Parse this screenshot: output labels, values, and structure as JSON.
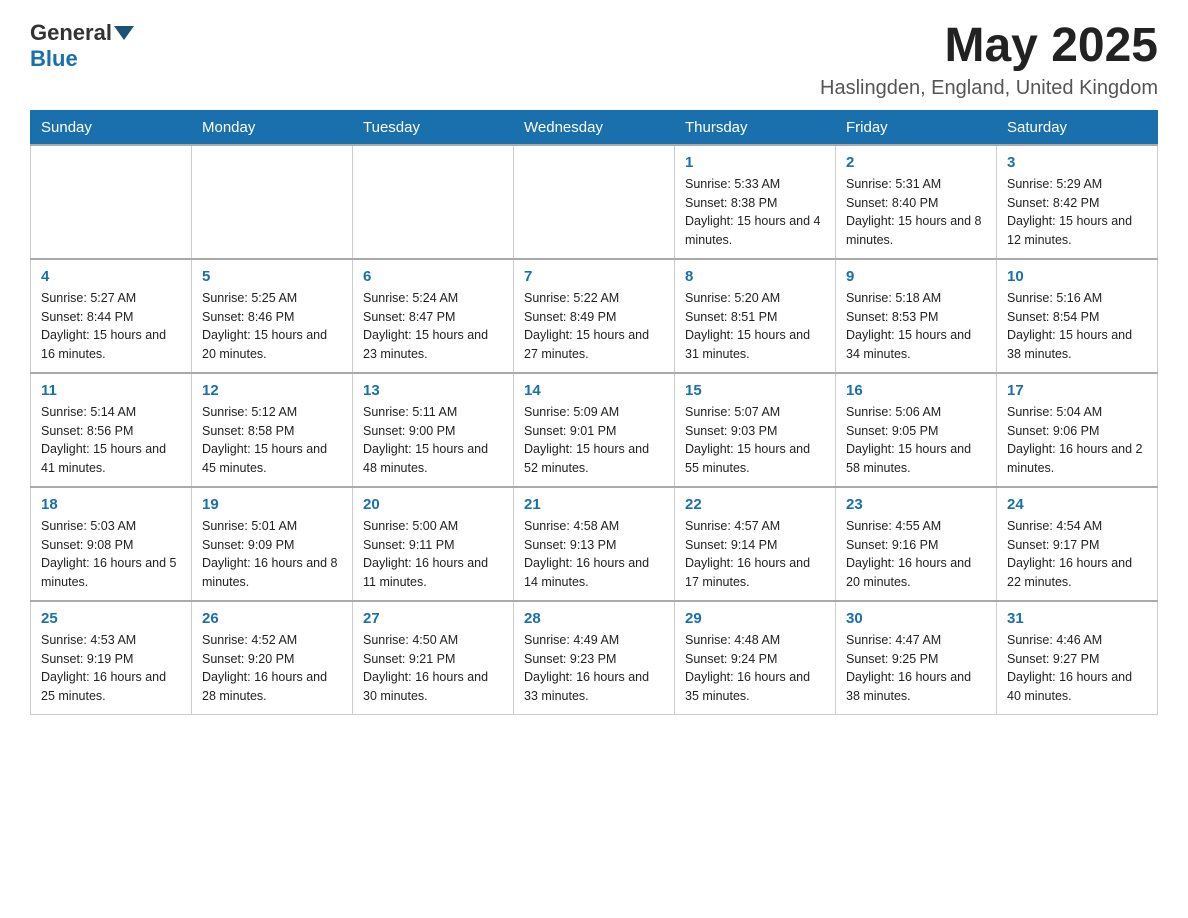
{
  "header": {
    "logo_general": "General",
    "logo_blue": "Blue",
    "month_title": "May 2025",
    "location": "Haslingden, England, United Kingdom"
  },
  "days_of_week": [
    "Sunday",
    "Monday",
    "Tuesday",
    "Wednesday",
    "Thursday",
    "Friday",
    "Saturday"
  ],
  "weeks": [
    [
      {
        "day": "",
        "info": ""
      },
      {
        "day": "",
        "info": ""
      },
      {
        "day": "",
        "info": ""
      },
      {
        "day": "",
        "info": ""
      },
      {
        "day": "1",
        "info": "Sunrise: 5:33 AM\nSunset: 8:38 PM\nDaylight: 15 hours and 4 minutes."
      },
      {
        "day": "2",
        "info": "Sunrise: 5:31 AM\nSunset: 8:40 PM\nDaylight: 15 hours and 8 minutes."
      },
      {
        "day": "3",
        "info": "Sunrise: 5:29 AM\nSunset: 8:42 PM\nDaylight: 15 hours and 12 minutes."
      }
    ],
    [
      {
        "day": "4",
        "info": "Sunrise: 5:27 AM\nSunset: 8:44 PM\nDaylight: 15 hours and 16 minutes."
      },
      {
        "day": "5",
        "info": "Sunrise: 5:25 AM\nSunset: 8:46 PM\nDaylight: 15 hours and 20 minutes."
      },
      {
        "day": "6",
        "info": "Sunrise: 5:24 AM\nSunset: 8:47 PM\nDaylight: 15 hours and 23 minutes."
      },
      {
        "day": "7",
        "info": "Sunrise: 5:22 AM\nSunset: 8:49 PM\nDaylight: 15 hours and 27 minutes."
      },
      {
        "day": "8",
        "info": "Sunrise: 5:20 AM\nSunset: 8:51 PM\nDaylight: 15 hours and 31 minutes."
      },
      {
        "day": "9",
        "info": "Sunrise: 5:18 AM\nSunset: 8:53 PM\nDaylight: 15 hours and 34 minutes."
      },
      {
        "day": "10",
        "info": "Sunrise: 5:16 AM\nSunset: 8:54 PM\nDaylight: 15 hours and 38 minutes."
      }
    ],
    [
      {
        "day": "11",
        "info": "Sunrise: 5:14 AM\nSunset: 8:56 PM\nDaylight: 15 hours and 41 minutes."
      },
      {
        "day": "12",
        "info": "Sunrise: 5:12 AM\nSunset: 8:58 PM\nDaylight: 15 hours and 45 minutes."
      },
      {
        "day": "13",
        "info": "Sunrise: 5:11 AM\nSunset: 9:00 PM\nDaylight: 15 hours and 48 minutes."
      },
      {
        "day": "14",
        "info": "Sunrise: 5:09 AM\nSunset: 9:01 PM\nDaylight: 15 hours and 52 minutes."
      },
      {
        "day": "15",
        "info": "Sunrise: 5:07 AM\nSunset: 9:03 PM\nDaylight: 15 hours and 55 minutes."
      },
      {
        "day": "16",
        "info": "Sunrise: 5:06 AM\nSunset: 9:05 PM\nDaylight: 15 hours and 58 minutes."
      },
      {
        "day": "17",
        "info": "Sunrise: 5:04 AM\nSunset: 9:06 PM\nDaylight: 16 hours and 2 minutes."
      }
    ],
    [
      {
        "day": "18",
        "info": "Sunrise: 5:03 AM\nSunset: 9:08 PM\nDaylight: 16 hours and 5 minutes."
      },
      {
        "day": "19",
        "info": "Sunrise: 5:01 AM\nSunset: 9:09 PM\nDaylight: 16 hours and 8 minutes."
      },
      {
        "day": "20",
        "info": "Sunrise: 5:00 AM\nSunset: 9:11 PM\nDaylight: 16 hours and 11 minutes."
      },
      {
        "day": "21",
        "info": "Sunrise: 4:58 AM\nSunset: 9:13 PM\nDaylight: 16 hours and 14 minutes."
      },
      {
        "day": "22",
        "info": "Sunrise: 4:57 AM\nSunset: 9:14 PM\nDaylight: 16 hours and 17 minutes."
      },
      {
        "day": "23",
        "info": "Sunrise: 4:55 AM\nSunset: 9:16 PM\nDaylight: 16 hours and 20 minutes."
      },
      {
        "day": "24",
        "info": "Sunrise: 4:54 AM\nSunset: 9:17 PM\nDaylight: 16 hours and 22 minutes."
      }
    ],
    [
      {
        "day": "25",
        "info": "Sunrise: 4:53 AM\nSunset: 9:19 PM\nDaylight: 16 hours and 25 minutes."
      },
      {
        "day": "26",
        "info": "Sunrise: 4:52 AM\nSunset: 9:20 PM\nDaylight: 16 hours and 28 minutes."
      },
      {
        "day": "27",
        "info": "Sunrise: 4:50 AM\nSunset: 9:21 PM\nDaylight: 16 hours and 30 minutes."
      },
      {
        "day": "28",
        "info": "Sunrise: 4:49 AM\nSunset: 9:23 PM\nDaylight: 16 hours and 33 minutes."
      },
      {
        "day": "29",
        "info": "Sunrise: 4:48 AM\nSunset: 9:24 PM\nDaylight: 16 hours and 35 minutes."
      },
      {
        "day": "30",
        "info": "Sunrise: 4:47 AM\nSunset: 9:25 PM\nDaylight: 16 hours and 38 minutes."
      },
      {
        "day": "31",
        "info": "Sunrise: 4:46 AM\nSunset: 9:27 PM\nDaylight: 16 hours and 40 minutes."
      }
    ]
  ]
}
